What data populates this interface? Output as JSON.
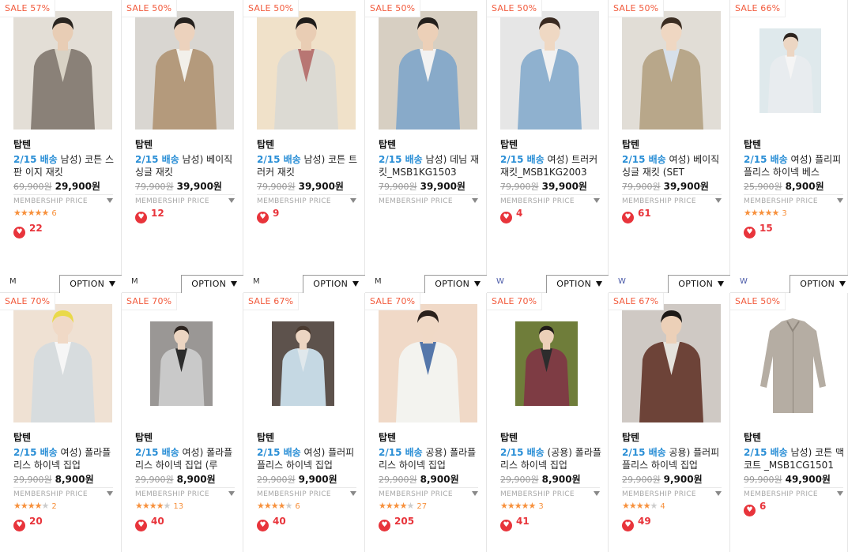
{
  "products": [
    [
      {
        "sale": "SALE 57%",
        "brand": "탑텐",
        "ship": "2/15 배송",
        "title": " 남성) 코튼 스판 이지 재킷",
        "orig": "69,900원",
        "price": "29,900원",
        "member": "MEMBERSHIP PRICE",
        "stars": "★★★★★",
        "empty": "",
        "rcount": "6",
        "likes": "22",
        "size": "M",
        "opt": "OPTION"
      },
      {
        "sale": "SALE 50%",
        "brand": "탑텐",
        "ship": "2/15 배송",
        "title": " 남성) 베이직 싱글 재킷",
        "orig": "79,900원",
        "price": "39,900원",
        "member": "MEMBERSHIP PRICE",
        "stars": "",
        "empty": "",
        "rcount": "",
        "likes": "12",
        "size": "M",
        "opt": "OPTION"
      },
      {
        "sale": "SALE 50%",
        "brand": "탑텐",
        "ship": "2/15 배송",
        "title": " 남성) 코튼 트러커 재킷",
        "orig": "79,900원",
        "price": "39,900원",
        "member": "MEMBERSHIP PRICE",
        "stars": "",
        "empty": "",
        "rcount": "",
        "likes": "9",
        "size": "M",
        "opt": "OPTION"
      },
      {
        "sale": "SALE 50%",
        "brand": "탑텐",
        "ship": "2/15 배송",
        "title": " 남성) 데님 재킷_MSB1KG1503",
        "orig": "79,900원",
        "price": "39,900원",
        "member": "MEMBERSHIP PRICE",
        "stars": "",
        "empty": "",
        "rcount": "",
        "likes": "",
        "size": "M",
        "opt": "OPTION"
      },
      {
        "sale": "SALE 50%",
        "brand": "탑텐",
        "ship": "2/15 배송",
        "title": " 여성) 트러커 재킷_MSB1KG2003",
        "orig": "79,900원",
        "price": "39,900원",
        "member": "MEMBERSHIP PRICE",
        "stars": "",
        "empty": "",
        "rcount": "",
        "likes": "4",
        "size": "W",
        "opt": "OPTION"
      },
      {
        "sale": "SALE 50%",
        "brand": "탑텐",
        "ship": "2/15 배송",
        "title": " 여성) 베이직 싱글 재킷 (SET",
        "orig": "79,900원",
        "price": "39,900원",
        "member": "MEMBERSHIP PRICE",
        "stars": "",
        "empty": "",
        "rcount": "",
        "likes": "61",
        "size": "W",
        "opt": "OPTION"
      },
      {
        "sale": "SALE 66%",
        "brand": "탑텐",
        "ship": "2/15 배송",
        "title": " 여성) 플리피플리스 하이넥 베스",
        "orig": "25,900원",
        "price": "8,900원",
        "member": "MEMBERSHIP PRICE",
        "stars": "★★★★★",
        "empty": "",
        "rcount": "3",
        "likes": "15",
        "size": "W",
        "opt": "OPTION"
      }
    ],
    [
      {
        "sale": "SALE 70%",
        "brand": "탑텐",
        "ship": "2/15 배송",
        "title": " 여성) 폴라플리스 하이넥 집업",
        "orig": "29,900원",
        "price": "8,900원",
        "member": "MEMBERSHIP PRICE",
        "stars": "★★★★",
        "empty": "★",
        "rcount": "2",
        "likes": "20"
      },
      {
        "sale": "SALE 70%",
        "brand": "탑텐",
        "ship": "2/15 배송",
        "title": " 여성) 폴라플리스 하이넥 집업 (루",
        "orig": "29,900원",
        "price": "8,900원",
        "member": "MEMBERSHIP PRICE",
        "stars": "★★★★",
        "empty": "★",
        "rcount": "13",
        "likes": "40"
      },
      {
        "sale": "SALE 67%",
        "brand": "탑텐",
        "ship": "2/15 배송",
        "title": " 여성) 플러피플리스 하이넥 집업",
        "orig": "29,900원",
        "price": "9,900원",
        "member": "MEMBERSHIP PRICE",
        "stars": "★★★★",
        "empty": "★",
        "rcount": "6",
        "likes": "40"
      },
      {
        "sale": "SALE 70%",
        "brand": "탑텐",
        "ship": "2/15 배송",
        "title": " 공용) 폴라플리스 하이넥 집업",
        "orig": "29,900원",
        "price": "8,900원",
        "member": "MEMBERSHIP PRICE",
        "stars": "★★★★",
        "empty": "★",
        "rcount": "27",
        "likes": "205"
      },
      {
        "sale": "SALE 70%",
        "brand": "탑텐",
        "ship": "2/15 배송",
        "title": " (공용) 폴라플리스 하이넥 집업",
        "orig": "29,900원",
        "price": "8,900원",
        "member": "MEMBERSHIP PRICE",
        "stars": "★★★★★",
        "empty": "",
        "rcount": "3",
        "likes": "41"
      },
      {
        "sale": "SALE 67%",
        "brand": "탑텐",
        "ship": "2/15 배송",
        "title": " 공용) 플러피플리스 하이넥 집업",
        "orig": "29,900원",
        "price": "9,900원",
        "member": "MEMBERSHIP PRICE",
        "stars": "★★★★",
        "empty": "★",
        "rcount": "4",
        "likes": "49"
      },
      {
        "sale": "SALE 50%",
        "brand": "탑텐",
        "ship": "2/15 배송",
        "title": " 남성) 코튼 맥 코트 _MSB1CG1501",
        "orig": "99,900원",
        "price": "49,900원",
        "member": "MEMBERSHIP PRICE",
        "stars": "",
        "empty": "",
        "rcount": "",
        "likes": "6"
      }
    ]
  ],
  "colors": {
    "sale": "#f25b3d",
    "ship": "#2b8fd6",
    "like": "#e8343b",
    "star": "#f7913d"
  },
  "icons": {
    "like": "heart-icon",
    "rating": "star-icon",
    "dropdown": "triangle-down-icon"
  }
}
